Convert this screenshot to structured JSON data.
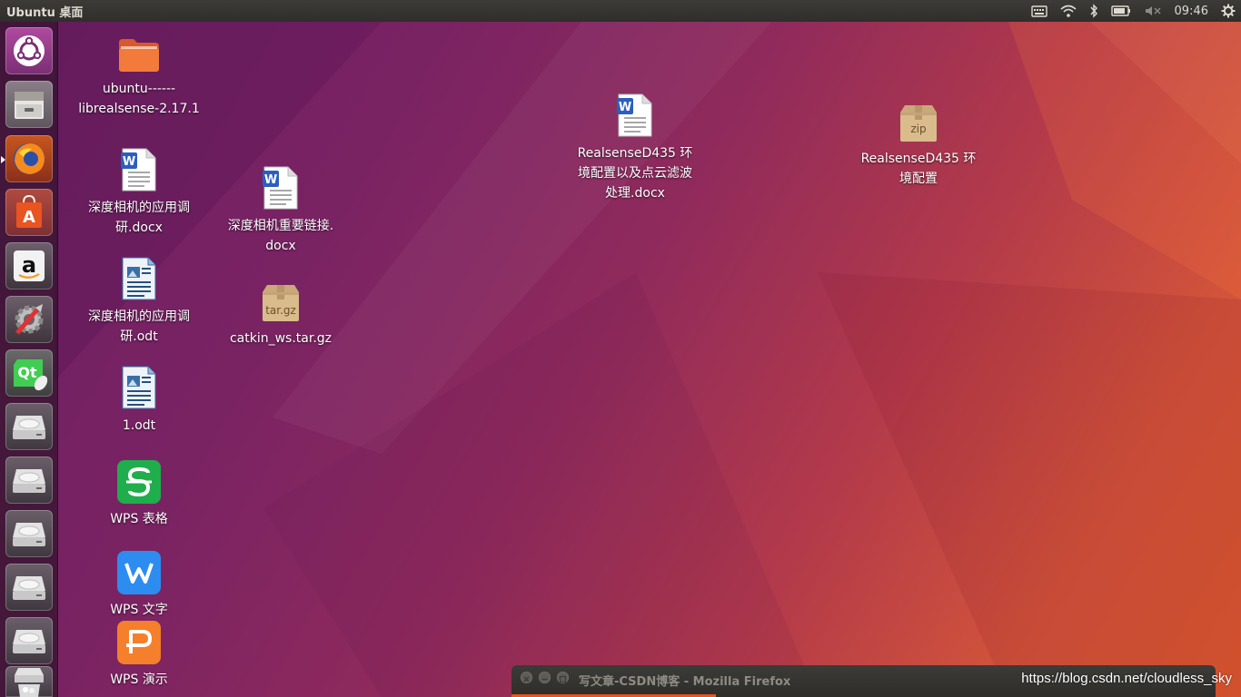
{
  "panel": {
    "title": "Ubuntu 桌面",
    "clock": "09:46",
    "indicators": [
      "keyboard-icon",
      "wifi-icon",
      "bluetooth-icon",
      "battery-icon",
      "volume-muted-icon",
      "gear-icon"
    ]
  },
  "launcher": {
    "items": [
      "ubuntu-dash",
      "files",
      "firefox",
      "ubuntu-software",
      "amazon",
      "system-settings",
      "qt-creator",
      "drive-1",
      "drive-2",
      "drive-3",
      "drive-4",
      "drive-5",
      "trash"
    ],
    "active": "firefox"
  },
  "desktop": {
    "icons": [
      {
        "label": "ubuntu------\nlibrealsense-2.17.1",
        "icon": "folder-icon"
      },
      {
        "label": "深度相机的应用调\n研.docx",
        "icon": "wps-doc-icon"
      },
      {
        "label": "深度相机重要链接.\ndocx",
        "icon": "wps-doc-icon"
      },
      {
        "label": "深度相机的应用调\n研.odt",
        "icon": "odt-icon"
      },
      {
        "label": "catkin_ws.tar.gz",
        "icon": "archive-icon",
        "badge": "tar.gz"
      },
      {
        "label": "1.odt",
        "icon": "odt-icon"
      },
      {
        "label": "WPS 表格",
        "icon": "wps-spreadsheet-icon"
      },
      {
        "label": "WPS 文字",
        "icon": "wps-writer-icon"
      },
      {
        "label": "WPS 演示",
        "icon": "wps-presentation-icon"
      },
      {
        "label": "RealsenseD435 环\n境配置以及点云滤波\n处理.docx",
        "icon": "wps-doc-icon"
      },
      {
        "label": "RealsenseD435 环\n境配置",
        "icon": "archive-icon",
        "badge": "zip"
      }
    ]
  },
  "window": {
    "title": "写文章-CSDN博客 - Mozilla Firefox"
  },
  "watermark": "https://blog.csdn.net/cloudless_sky",
  "colors": {
    "accent": "#e95420",
    "panel": "#3c3b37"
  }
}
